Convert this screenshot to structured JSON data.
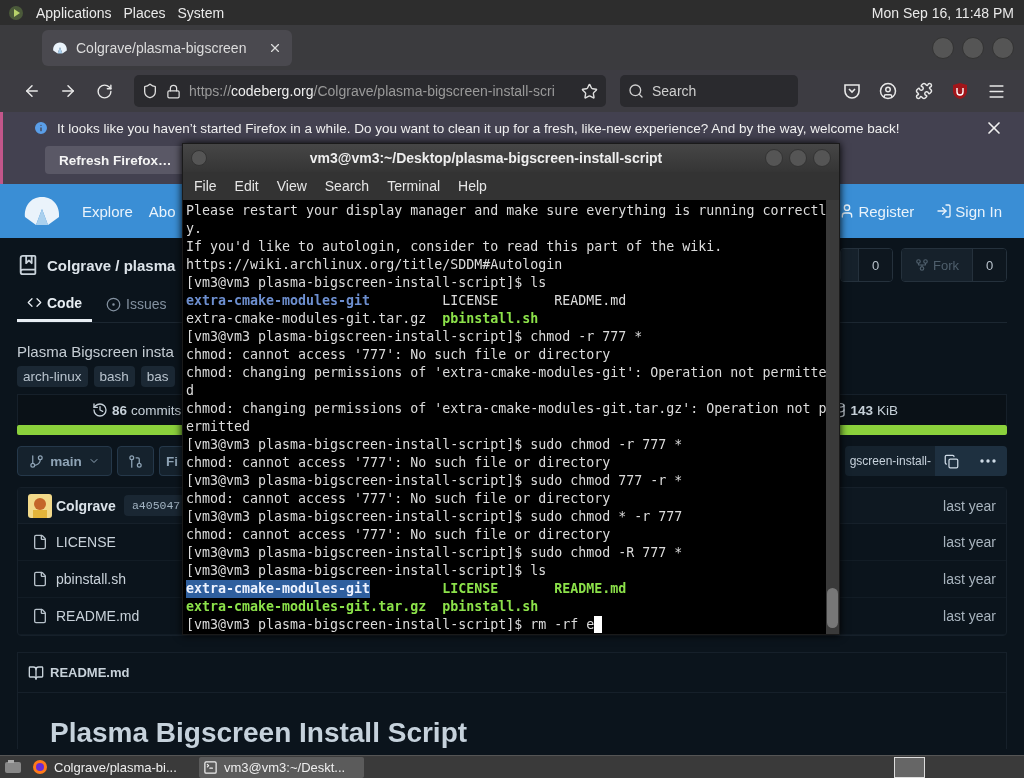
{
  "top_panel": {
    "menus": [
      "Applications",
      "Places",
      "System"
    ],
    "clock": "Mon Sep 16, 11:48 PM"
  },
  "browser": {
    "tabs": [
      {
        "title": "Colgrave/plasma-bigscreen",
        "selected": true
      }
    ],
    "url": {
      "scheme": "https://",
      "host": "codeberg.org",
      "path": "/Colgrave/plasma-bigscreen-install-scri"
    },
    "search": {
      "placeholder": "Search"
    },
    "notification": {
      "message": "It looks like you haven’t started Firefox in a while. Do you want to clean it up for a fresh, like-new experience? And by the way, welcome back!",
      "button": "Refresh Firefox…"
    }
  },
  "site": {
    "nav": [
      "Explore",
      "Abo"
    ],
    "account": [
      {
        "label": "Register",
        "kind": "register"
      },
      {
        "label": "Sign In",
        "kind": "signin"
      }
    ],
    "repo": {
      "title": "Colgrave / plasma",
      "star_count": "0",
      "fork_label": "Fork",
      "fork_count": "0"
    },
    "tabs": [
      {
        "label": "Code",
        "kind": "code",
        "selected": true
      },
      {
        "label": "Issues",
        "kind": "issues",
        "selected": false
      }
    ],
    "description": "Plasma Bigscreen insta",
    "topics": [
      "arch-linux",
      "bash",
      "bas"
    ],
    "stats": {
      "commits_count": "86",
      "commits_label": "commits",
      "size_value": "143",
      "size_unit": "KiB"
    },
    "branch": {
      "name": "main",
      "find_label": "Fi",
      "clone_url": "gscreen-install-"
    },
    "last_commit": {
      "author": "Colgrave",
      "sha": "a405047",
      "time": "last year"
    },
    "files": [
      {
        "name": "LICENSE",
        "time": "last year"
      },
      {
        "name": "pbinstall.sh",
        "time": "last year"
      },
      {
        "name": "README.md",
        "time": "last year"
      }
    ],
    "readme": {
      "title": "README.md",
      "heading": "Plasma Bigscreen Install Script"
    }
  },
  "terminal": {
    "title": "vm3@vm3:~/Desktop/plasma-bigscreen-install-script",
    "menus": [
      "File",
      "Edit",
      "View",
      "Search",
      "Terminal",
      "Help"
    ],
    "lines": [
      {
        "kind": "text",
        "text": "Please restart your display manager and make sure everything is running correctl"
      },
      {
        "kind": "text",
        "text": "y."
      },
      {
        "kind": "text",
        "text": "If you'd like to autologin, consider to read this part of the wiki."
      },
      {
        "kind": "text",
        "text": "https://wiki.archlinux.org/title/SDDM#Autologin"
      },
      {
        "kind": "text",
        "text": "[vm3@vm3 plasma-bigscreen-install-script]$ ls"
      },
      {
        "kind": "ls",
        "cells": [
          {
            "text": "extra-cmake-modules-git",
            "kind": "dir"
          },
          {
            "text": "LICENSE",
            "kind": "plain"
          },
          {
            "text": "README.md",
            "kind": "plain"
          }
        ]
      },
      {
        "kind": "ls",
        "cells": [
          {
            "text": "extra-cmake-modules-git.tar.gz",
            "kind": "plain"
          },
          {
            "text": "pbinstall.sh",
            "kind": "exec"
          }
        ]
      },
      {
        "kind": "text",
        "text": "[vm3@vm3 plasma-bigscreen-install-script]$ chmod -r 777 *"
      },
      {
        "kind": "text",
        "text": "chmod: cannot access '777': No such file or directory"
      },
      {
        "kind": "text",
        "text": "chmod: changing permissions of 'extra-cmake-modules-git': Operation not permitte"
      },
      {
        "kind": "text",
        "text": "d"
      },
      {
        "kind": "text",
        "text": "chmod: changing permissions of 'extra-cmake-modules-git.tar.gz': Operation not p"
      },
      {
        "kind": "text",
        "text": "ermitted"
      },
      {
        "kind": "text",
        "text": "[vm3@vm3 plasma-bigscreen-install-script]$ sudo chmod -r 777 *"
      },
      {
        "kind": "text",
        "text": "chmod: cannot access '777': No such file or directory"
      },
      {
        "kind": "text",
        "text": "[vm3@vm3 plasma-bigscreen-install-script]$ sudo chmod 777 -r *"
      },
      {
        "kind": "text",
        "text": "chmod: cannot access '777': No such file or directory"
      },
      {
        "kind": "text",
        "text": "[vm3@vm3 plasma-bigscreen-install-script]$ sudo chmod * -r 777"
      },
      {
        "kind": "text",
        "text": "chmod: cannot access '777': No such file or directory"
      },
      {
        "kind": "text",
        "text": "[vm3@vm3 plasma-bigscreen-install-script]$ sudo chmod -R 777 *"
      },
      {
        "kind": "text",
        "text": "[vm3@vm3 plasma-bigscreen-install-script]$ ls"
      },
      {
        "kind": "ls",
        "cells": [
          {
            "text": "extra-cmake-modules-git",
            "kind": "selected"
          },
          {
            "text": "LICENSE",
            "kind": "exec"
          },
          {
            "text": "README.md",
            "kind": "exec"
          }
        ]
      },
      {
        "kind": "ls",
        "cells": [
          {
            "text": "extra-cmake-modules-git.tar.gz",
            "kind": "exec"
          },
          {
            "text": "pbinstall.sh",
            "kind": "exec"
          }
        ]
      }
    ],
    "input": {
      "text": "[vm3@vm3 plasma-bigscreen-install-script]$ rm -rf e",
      "cursor": true
    }
  },
  "taskbar": {
    "tasks": [
      {
        "title": "Colgrave/plasma-bi...",
        "kind": "browser",
        "selected": false
      },
      {
        "title": "vm3@vm3:~/Deskt...",
        "kind": "terminal",
        "selected": true
      }
    ]
  }
}
